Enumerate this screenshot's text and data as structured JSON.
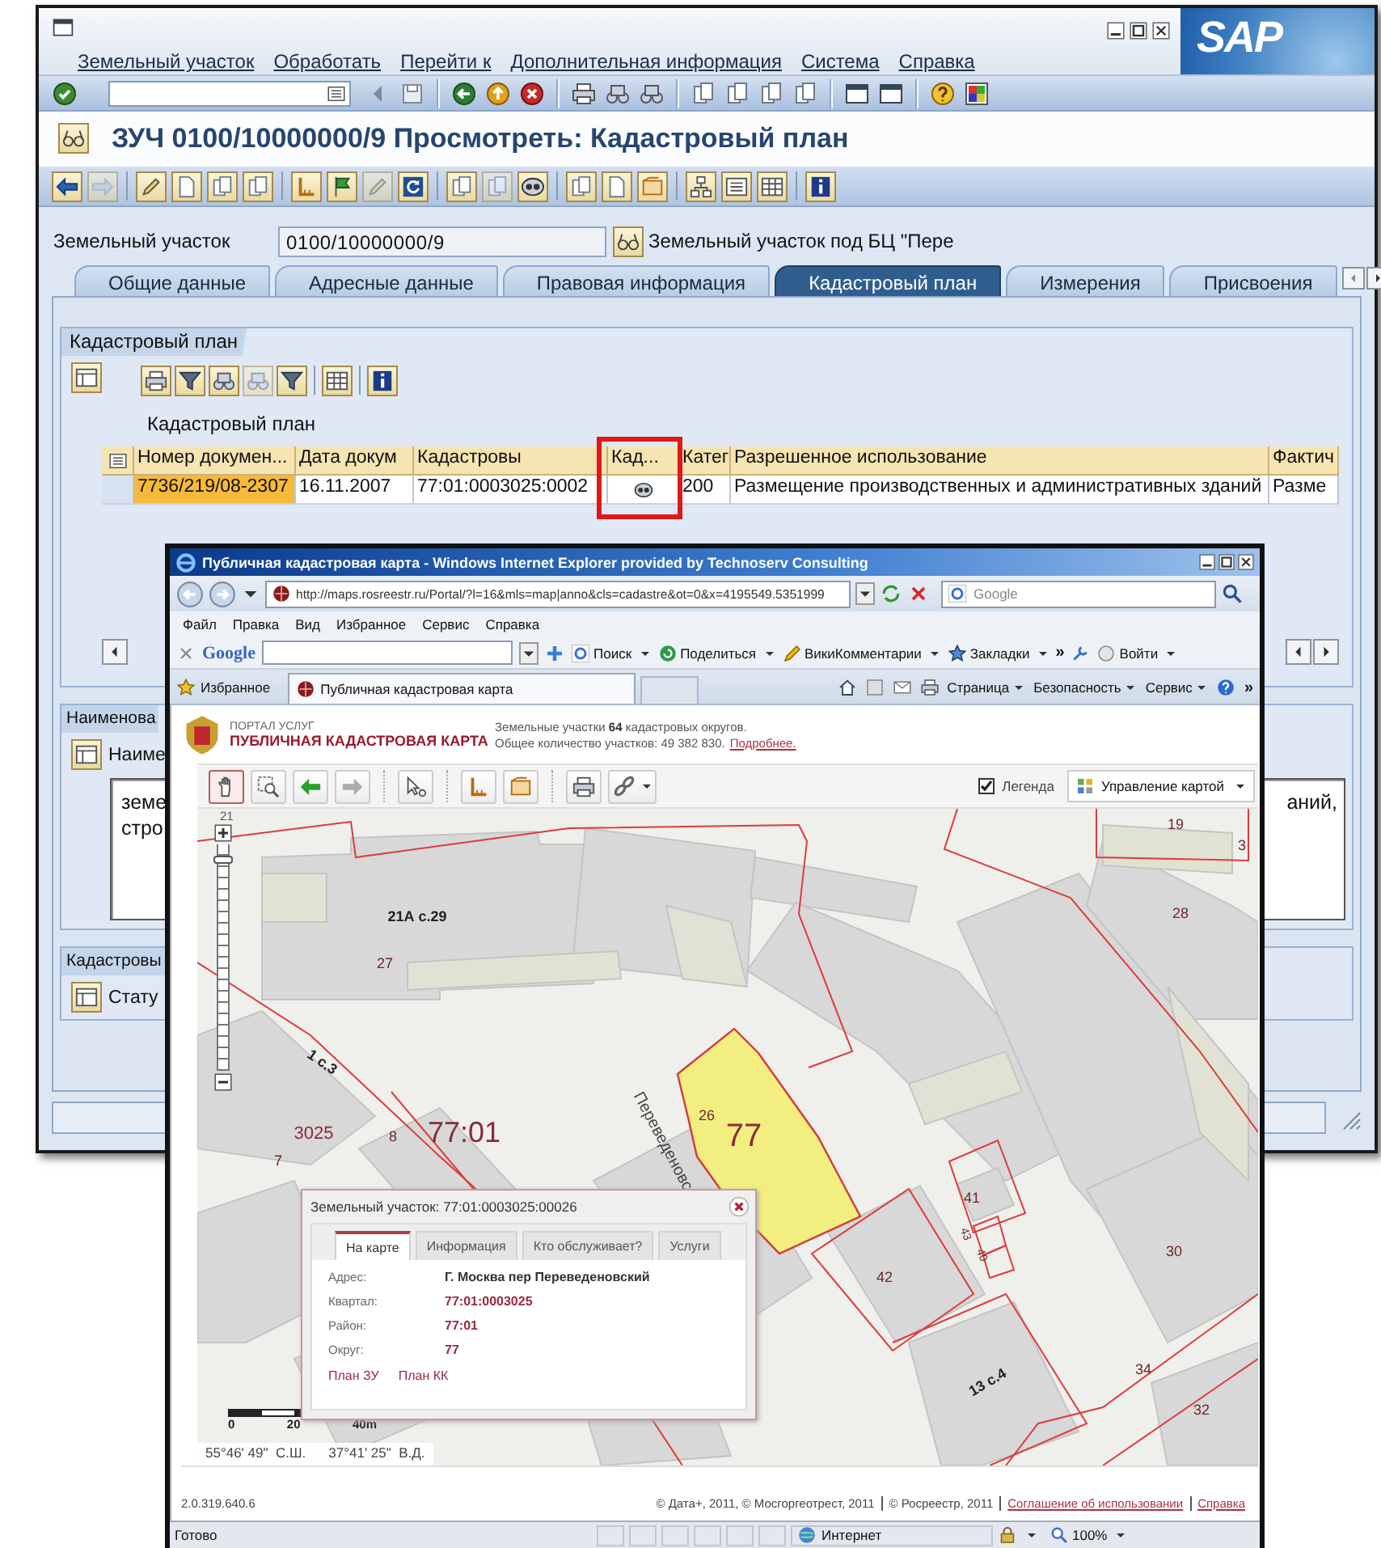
{
  "sap": {
    "logo": "SAP",
    "menu": [
      "Земельный участок",
      "Обработать",
      "Перейти к",
      "Дополнительная информация",
      "Система",
      "Справка"
    ],
    "title": "ЗУЧ 0100/10000000/9 Просмотреть: Кадастровый план",
    "object_field": {
      "label": "Земельный участок",
      "value": "0100/10000000/9",
      "description": "Земельный участок под БЦ \"Пере"
    },
    "tabs": [
      {
        "label": "Общие данные",
        "selected": false
      },
      {
        "label": "Адресные данные",
        "selected": false
      },
      {
        "label": "Правовая информация",
        "selected": false
      },
      {
        "label": "Кадастровый план",
        "selected": true
      },
      {
        "label": "Измерения",
        "selected": false
      },
      {
        "label": "Присвоения",
        "selected": false
      }
    ],
    "cadastral_plan": {
      "group_title": "Кадастровый план",
      "grid_title": "Кадастровый план",
      "columns": [
        {
          "label": "Номер докумен...",
          "kind": "text"
        },
        {
          "label": "Дата докум",
          "kind": "text"
        },
        {
          "label": "Кадастровы",
          "kind": "text"
        },
        {
          "label": "Кад...",
          "kind": "icon"
        },
        {
          "label": "Катег",
          "kind": "text"
        },
        {
          "label": "Разрешенное использование",
          "kind": "text"
        },
        {
          "label": "Фактич",
          "kind": "text"
        }
      ],
      "rows": [
        {
          "cells": [
            {
              "text": "7736/219/08-2307",
              "selected": true
            },
            {
              "text": "16.11.2007",
              "selected": false
            },
            {
              "text": "77:01:0003025:0002",
              "selected": false
            },
            {
              "text": "",
              "selected": false
            },
            {
              "text": "200",
              "selected": false
            },
            {
              "text": "Размещение производственных и административных зданий",
              "selected": false
            },
            {
              "text": "Разме",
              "selected": false
            }
          ]
        }
      ]
    },
    "name_group": {
      "group_title": "Наименова",
      "label": "Наиме",
      "text_left": [
        "земе",
        "стро"
      ],
      "text_right": "аний,"
    },
    "status_group": {
      "group_title": "Кадастровы",
      "label": "Стату"
    }
  },
  "ie": {
    "title": "Публичная кадастровая карта - Windows Internet Explorer provided by Technoserv Consulting",
    "address": "http://maps.rosreestr.ru/Portal/?l=16&mls=map|anno&cls=cadastre&ot=0&x=4195549.5351999",
    "search_placeholder": "Google",
    "menu": [
      "Файл",
      "Правка",
      "Вид",
      "Избранное",
      "Сервис",
      "Справка"
    ],
    "google_bar": {
      "logo": "Google",
      "buttons": [
        "Поиск",
        "Поделиться",
        "ВикиКомментарии",
        "Закладки"
      ],
      "more": "»",
      "sign_in": "Войти"
    },
    "favorites": "Избранное",
    "tab_title": "Публичная кадастровая карта",
    "command_bar": {
      "menus": [
        "Страница",
        "Безопасность",
        "Сервис"
      ],
      "more": "»"
    },
    "portal": {
      "caption": "ПОРТАЛ УСЛУГ",
      "name": "ПУБЛИЧНАЯ КАДАСТРОВАЯ КАРТА",
      "stats": "Земельные участки **64** кадастровых округов.",
      "count": "Общее количество участков: 49 382 830.",
      "more_link": "Подробнее."
    },
    "legend": {
      "label": "Легенда",
      "checked": true
    },
    "map_control": "Управление картой",
    "map": {
      "zoom_level": "21",
      "zoom_slider": {
        "level": 0.95
      },
      "labels": [
        "21А с.29",
        "27",
        "1 с.3",
        "3025",
        "8",
        "77:01",
        "7",
        "26",
        "77",
        "Переведеновс",
        "19",
        "3",
        "28",
        "41",
        "43",
        "40",
        "42",
        "30",
        "34",
        "13 с.4",
        "32"
      ],
      "scale": [
        "0",
        "20",
        "40m"
      ],
      "latitude": "55°46' 49\"  С.Ш.",
      "longitude": "37°41' 25\"  В.Д."
    },
    "popup": {
      "title": "Земельный участок: 77:01:0003025:00026",
      "tabs": [
        {
          "label": "На карте",
          "selected": true
        },
        {
          "label": "Информация",
          "selected": false
        },
        {
          "label": "Кто обслуживает?",
          "selected": false
        },
        {
          "label": "Услуги",
          "selected": false
        }
      ],
      "fields": [
        {
          "label": "Адрес:",
          "value": "Г. Москва пер Переведеновский",
          "kind": "plain"
        },
        {
          "label": "Квартал:",
          "value": "77:01:0003025",
          "kind": "link"
        },
        {
          "label": "Район:",
          "value": "77:01",
          "kind": "link"
        },
        {
          "label": "Округ:",
          "value": "77",
          "kind": "link"
        }
      ],
      "links": [
        "План ЗУ",
        "План КК"
      ]
    },
    "footer": {
      "version": "2.0.319.640.6",
      "copyright": [
        "© Дата+, 2011, © Мосгоргеотрест, 2011",
        "© Росреестр, 2011"
      ],
      "links": [
        "Соглашение об использовании",
        "Справка"
      ]
    },
    "status": {
      "text": "Готово",
      "zone": "Интернет",
      "zoom": "100%"
    }
  }
}
